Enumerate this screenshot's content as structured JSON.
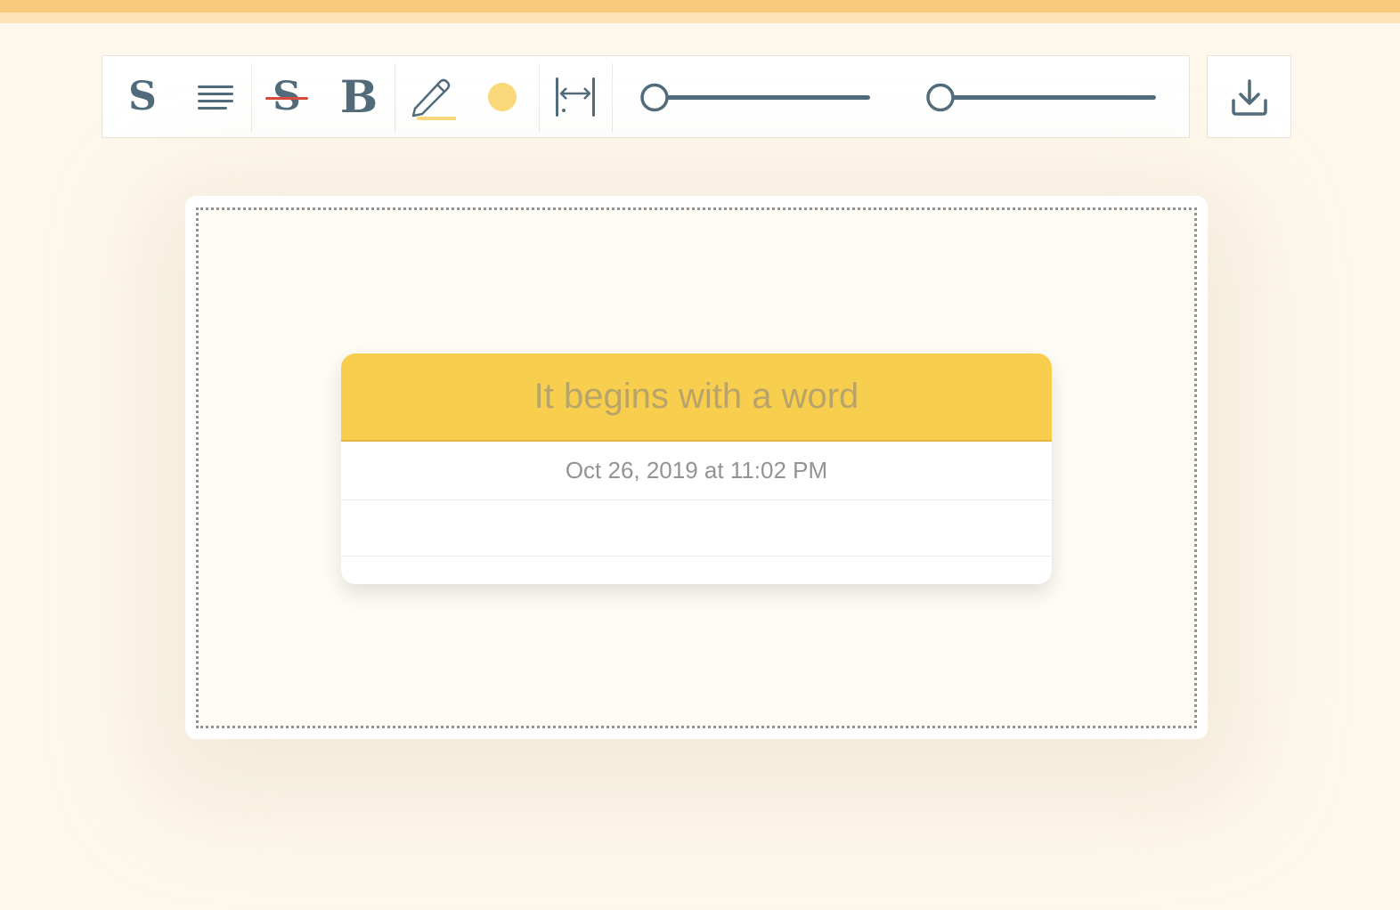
{
  "toolbar": {
    "font_style_label": "S",
    "strikethrough_label": "S",
    "bold_label": "B",
    "highlight_color": "#f9d979",
    "text_color": "#516b7a",
    "strike_color": "#d94a3a",
    "icons": [
      "font-style-icon",
      "align-icon",
      "strikethrough-icon",
      "bold-icon",
      "pencil-icon",
      "color-dot-icon",
      "width-icon",
      "slider",
      "slider",
      "download-icon"
    ]
  },
  "card": {
    "title": "It begins with a word",
    "date": "Oct 26, 2019 at 11:02 PM",
    "header_color": "#f8ce4f"
  },
  "colors": {
    "background": "#fef8ec",
    "top_bar": "#f8c97c",
    "accent": "#516b7a"
  }
}
